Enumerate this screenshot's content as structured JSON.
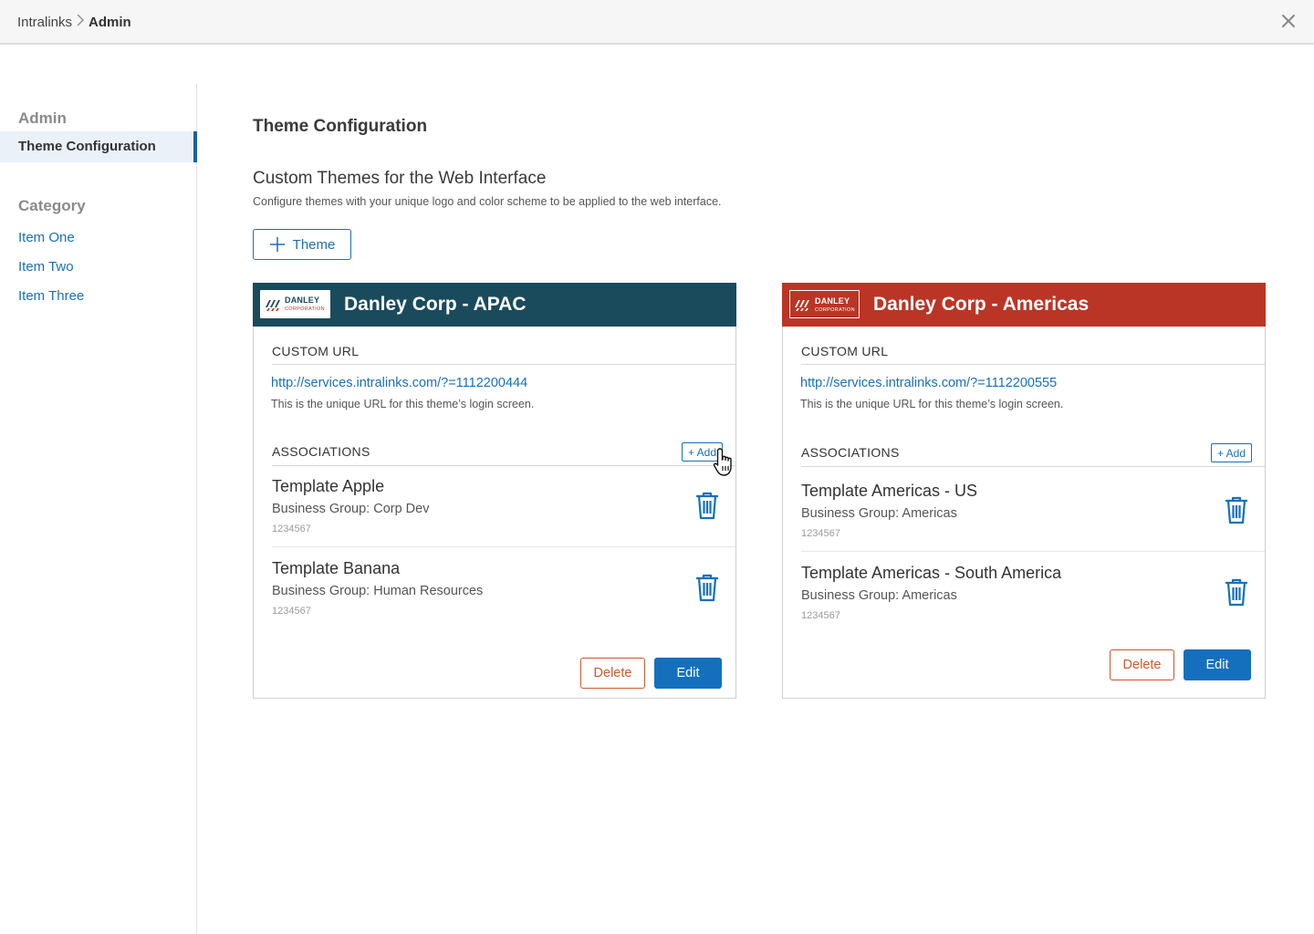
{
  "header": {
    "breadcrumb": [
      "Intralinks",
      "Admin"
    ],
    "close_icon": "close-icon"
  },
  "sidebar": {
    "section_admin": "Admin",
    "active_item": "Theme Configuration",
    "section_category": "Category",
    "items": [
      "Item One",
      "Item Two",
      "Item Three"
    ],
    "accent_color": "#1b5fa7"
  },
  "main": {
    "title": "Theme Configuration",
    "subtitle": "Custom Themes for the Web Interface",
    "description": "Configure themes with your unique logo and color scheme to be applied to the web interface.",
    "theme_button": "Theme",
    "theme_button_icon": "plus-icon"
  },
  "cards": [
    {
      "title": "Danley Corp - APAC",
      "header_color": "#1a4b5c",
      "logo_line1": "DANLEY",
      "logo_line2": "CORPORATION",
      "custom_url_label": "CUSTOM URL",
      "url": "http://services.intralinks.com/?=1112200444",
      "url_hint": "This is the unique URL for this theme’s login screen.",
      "associations_label": "ASSOCIATIONS",
      "add_label": "+ Add",
      "associations": [
        {
          "name": "Template Apple",
          "group": "Business Group: Corp Dev",
          "id": "1234567"
        },
        {
          "name": "Template Banana",
          "group": "Business Group: Human Resources",
          "id": "1234567"
        }
      ],
      "delete_label": "Delete",
      "edit_label": "Edit"
    },
    {
      "title": "Danley Corp - Americas",
      "header_color": "#bb3526",
      "logo_line1": "DANLEY",
      "logo_line2": "CORPORATION",
      "custom_url_label": "CUSTOM URL",
      "url": "http://services.intralinks.com/?=1112200555",
      "url_hint": "This is the unique URL for this theme’s login screen.",
      "associations_label": "ASSOCIATIONS",
      "add_label": "+ Add",
      "associations": [
        {
          "name": "Template Americas - US",
          "group": "Business Group: Americas",
          "id": "1234567"
        },
        {
          "name": "Template Americas - South America",
          "group": "Business Group: Americas",
          "id": "1234567"
        }
      ],
      "delete_label": "Delete",
      "edit_label": "Edit"
    }
  ],
  "colors": {
    "link": "#1a6fb5",
    "delete": "#c65a2e",
    "edit": "#1470bd"
  }
}
